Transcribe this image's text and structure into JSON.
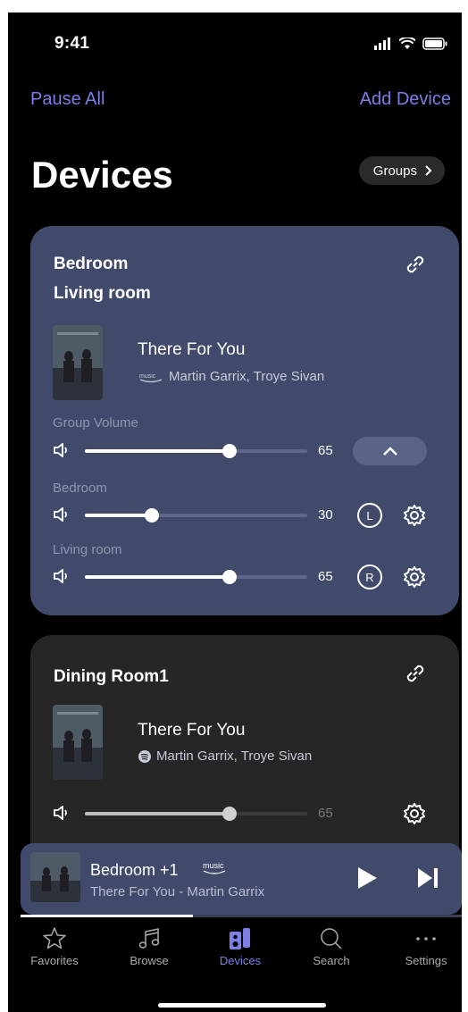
{
  "status": {
    "time": "9:41"
  },
  "header": {
    "pause_all": "Pause All",
    "add_device": "Add Device",
    "title": "Devices",
    "groups_label": "Groups"
  },
  "group_card": {
    "rooms": [
      "Bedroom",
      "Living room"
    ],
    "song": "There For You",
    "service_icon": "amazon-music-icon",
    "artist": "Martin Garrix, Troye Sivan",
    "group_volume": {
      "label": "Group Volume",
      "value": 65,
      "value_text": "65"
    },
    "devices": [
      {
        "label": "Bedroom",
        "value": 30,
        "value_text": "30",
        "channel": "L"
      },
      {
        "label": "Living room",
        "value": 65,
        "value_text": "65",
        "channel": "R"
      }
    ]
  },
  "single_card": {
    "room": "Dining Room1",
    "song": "There For You",
    "service_icon": "spotify-icon",
    "artist": "Martin Garrix, Troye Sivan",
    "volume": {
      "value": 65,
      "value_text": "65"
    }
  },
  "mini_player": {
    "device": "Bedroom +1",
    "service": "music",
    "subtitle": "There For You - Martin Garrix",
    "progress": 0.39
  },
  "tabs": [
    {
      "label": "Favorites",
      "icon": "star-icon",
      "active": false
    },
    {
      "label": "Browse",
      "icon": "music-note-icon",
      "active": false
    },
    {
      "label": "Devices",
      "icon": "speaker-icon",
      "active": true
    },
    {
      "label": "Search",
      "icon": "search-icon",
      "active": false
    },
    {
      "label": "Settings",
      "icon": "more-dots-icon",
      "active": false
    }
  ],
  "colors": {
    "accent": "#7b7fe6",
    "card_active": "#424a6c",
    "card_idle": "#262626"
  }
}
